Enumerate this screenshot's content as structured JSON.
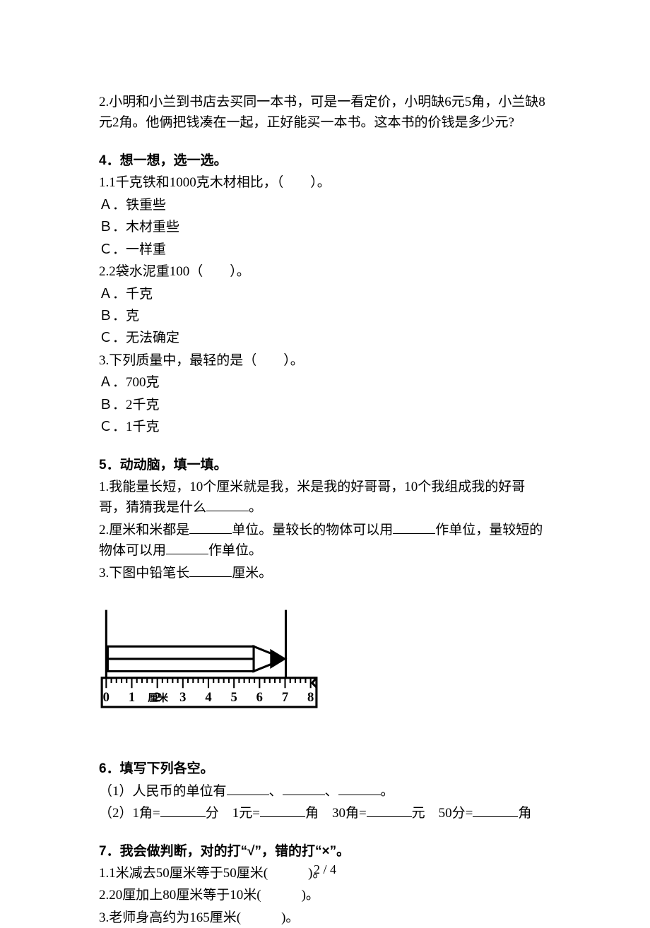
{
  "q_prev": {
    "num": "2.",
    "text": "小明和小兰到书店去买同一本书，可是一看定价，小明缺6元5角，小兰缺8元2角。他俩把钱凑在一起，正好能买一本书。这本书的价钱是多少元?"
  },
  "s4": {
    "heading_num": "4．",
    "heading_text": "想一想，选一选。",
    "q1": {
      "stem": "1.1千克铁和1000克木材相比，（　　）。",
      "A": "Ａ．铁重些",
      "B": "Ｂ．木材重些",
      "C": "Ｃ．一样重"
    },
    "q2": {
      "stem": "2.2袋水泥重100（　　）。",
      "A": "Ａ．千克",
      "B": "Ｂ．克",
      "C": "Ｃ．无法确定"
    },
    "q3": {
      "stem": "3.下列质量中，最轻的是（　　）。",
      "A": "Ａ．700克",
      "B": "Ｂ．2千克",
      "C": "Ｃ．1千克"
    }
  },
  "s5": {
    "heading_num": "5．",
    "heading_text": "动动脑，填一填。",
    "q1_a": "1.我能量长短，10个厘米就是我，米是我的好哥哥，10个我组成我的好哥哥，猜猜我是什么",
    "q1_b": "。",
    "q2_a": "2.厘米和米都是",
    "q2_b": "单位。量较长的物体可以用",
    "q2_c": "作单位，量较短的物体可以用",
    "q2_d": "作单位。",
    "q3_a": "3.下图中铅笔长",
    "q3_b": "厘米。"
  },
  "ruler": {
    "numbers": [
      "0",
      "1",
      "2",
      "3",
      "4",
      "5",
      "6",
      "7",
      "8"
    ],
    "unit_label": "厘米"
  },
  "s6": {
    "heading_num": "6．",
    "heading_text": "填写下列各空。",
    "l1_a": "（1）人民币的单位有",
    "l1_sep": "、",
    "l1_end": "。",
    "l2_a": "（2）1角=",
    "l2_b": "分 1元=",
    "l2_c": "角 30角=",
    "l2_d": "元 50分=",
    "l2_e": "角"
  },
  "s7": {
    "heading_num": "7．",
    "heading_text": "我会做判断，对的打“√”，错的打“×”。",
    "i1": "1.1米减去50厘米等于50厘米(　　　)。",
    "i2": "2.20厘加上80厘米等于10米(　　　)。",
    "i3": "3.老师身高约为165厘米(　　　)。"
  },
  "page_footer": "2 / 4"
}
